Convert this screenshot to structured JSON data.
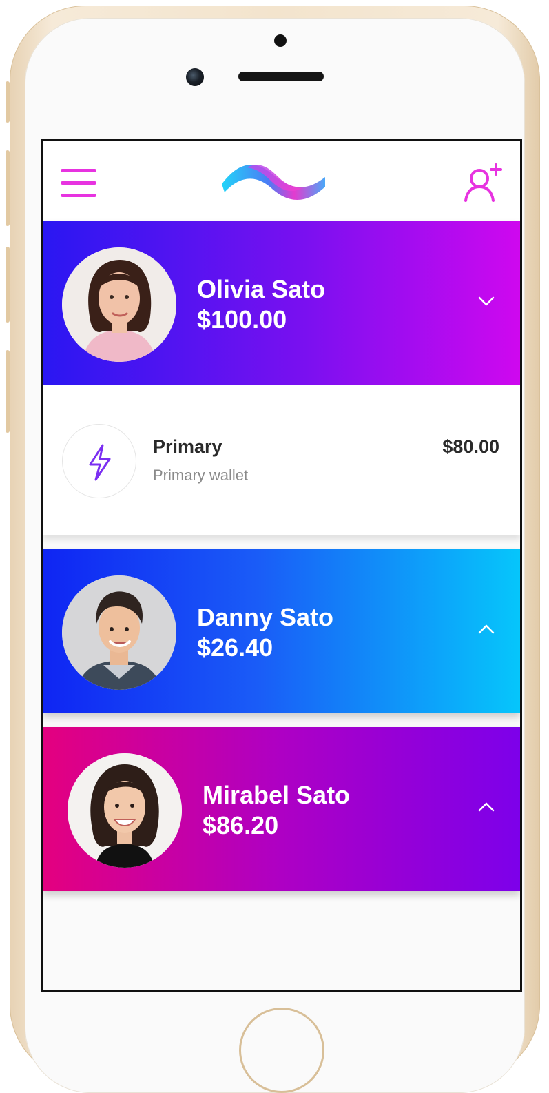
{
  "header": {
    "menu_icon": "hamburger-menu-icon",
    "logo": "wave-logo",
    "add_user_icon": "add-user-icon",
    "accent_color": "#e733e0"
  },
  "accounts": [
    {
      "name": "Olivia Sato",
      "balance": "$100.00",
      "expanded": true,
      "chevron": "chevron-down-icon",
      "gradient": [
        "#2a17f2",
        "#cf08ef"
      ]
    },
    {
      "name": "Danny Sato",
      "balance": "$26.40",
      "expanded": false,
      "chevron": "chevron-up-icon",
      "gradient": [
        "#0f25f3",
        "#06c6fb"
      ]
    },
    {
      "name": "Mirabel Sato",
      "balance": "$86.20",
      "expanded": false,
      "chevron": "chevron-up-icon",
      "gradient": [
        "#e4007f",
        "#7d00ea"
      ]
    }
  ],
  "wallet": {
    "name": "Primary",
    "description": "Primary wallet",
    "amount": "$80.00",
    "icon": "lightning-bolt-icon",
    "icon_color": "#7b2ef2"
  }
}
